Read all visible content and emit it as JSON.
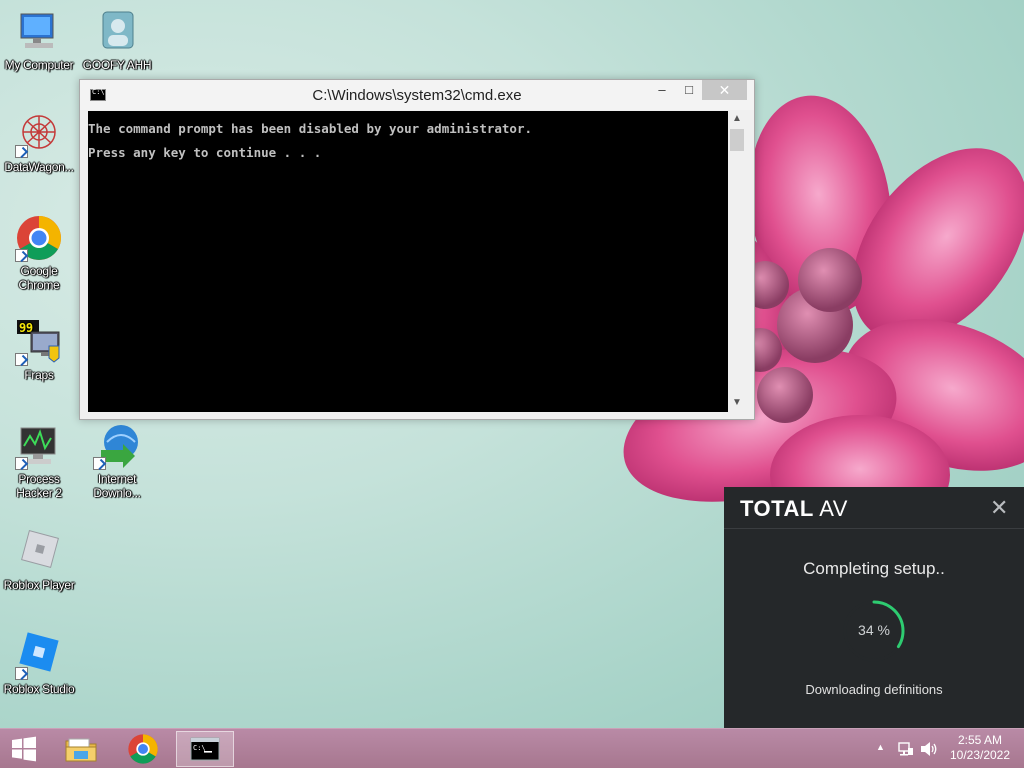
{
  "desktop": {
    "icons": [
      {
        "label": "My Computer",
        "icon": "computer-icon"
      },
      {
        "label": "GOOFY AHH",
        "icon": "user-folder-icon"
      },
      {
        "label": "DataWagon...",
        "icon": "datawagon-icon"
      },
      {
        "label": "Google Chrome",
        "icon": "chrome-icon"
      },
      {
        "label": "Fraps",
        "icon": "fraps-icon"
      },
      {
        "label": "Process Hacker 2",
        "icon": "process-hacker-icon"
      },
      {
        "label": "Internet Downlo...",
        "icon": "internet-download-manager-icon"
      },
      {
        "label": "Roblox Player",
        "icon": "roblox-player-icon"
      },
      {
        "label": "Roblox Studio",
        "icon": "roblox-studio-icon"
      }
    ]
  },
  "cmd": {
    "title": "C:\\Windows\\system32\\cmd.exe",
    "lines": [
      "The command prompt has been disabled by your administrator.",
      "Press any key to continue . . ."
    ],
    "min_label": "–",
    "max_label": "□",
    "close_label": "✕"
  },
  "totalav": {
    "logo_bold": "TOTAL",
    "logo_light": "AV",
    "close_label": "✕",
    "status": "Completing setup..",
    "progress_percent": 34,
    "progress_label": "34 %",
    "sub_status": "Downloading definitions",
    "accent_color": "#2ecc71"
  },
  "taskbar": {
    "buttons": [
      "start-icon",
      "file-explorer-icon",
      "chrome-icon",
      "cmd-icon"
    ],
    "time": "2:55 AM",
    "date": "10/23/2022"
  }
}
